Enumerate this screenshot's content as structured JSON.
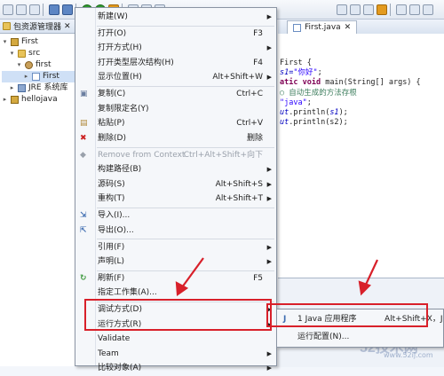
{
  "explorer": {
    "title": "包资源管理器",
    "tree": [
      {
        "label": "First",
        "level": 0,
        "expanded": true,
        "icon": "project-icon"
      },
      {
        "label": "src",
        "level": 1,
        "expanded": true,
        "icon": "folder-icon"
      },
      {
        "label": "first",
        "level": 2,
        "expanded": true,
        "icon": "package-icon"
      },
      {
        "label": "First",
        "level": 3,
        "expanded": false,
        "icon": "java-file-icon"
      },
      {
        "label": "JRE 系统库",
        "level": 1,
        "expanded": false,
        "icon": "library-icon"
      },
      {
        "label": "hellojava",
        "level": 0,
        "expanded": false,
        "icon": "project-icon"
      }
    ]
  },
  "editor": {
    "tab_label": "First.java",
    "lines": [
      {
        "parts": [
          {
            "t": "First {",
            "c": ""
          }
        ]
      },
      {
        "parts": [
          {
            "t": "s1=",
            "c": "fld"
          },
          {
            "t": "\"你好\"",
            "c": "str"
          },
          {
            "t": ";",
            "c": ""
          }
        ]
      },
      {
        "parts": [
          {
            "t": "atic ",
            "c": "kw"
          },
          {
            "t": "void",
            "c": "kw"
          },
          {
            "t": " main(String[] args) {",
            "c": ""
          }
        ]
      },
      {
        "parts": [
          {
            "t": "○ 自动生成的方法存根",
            "c": "com"
          }
        ]
      },
      {
        "parts": [
          {
            "t": "\"java\"",
            "c": "str"
          },
          {
            "t": ";",
            "c": ""
          }
        ]
      },
      {
        "parts": [
          {
            "t": "ut",
            "c": "fld"
          },
          {
            "t": ".println(",
            "c": ""
          },
          {
            "t": "s1",
            "c": "fld"
          },
          {
            "t": ");",
            "c": ""
          }
        ]
      },
      {
        "parts": [
          {
            "t": "ut",
            "c": "fld"
          },
          {
            "t": ".println(s2);",
            "c": ""
          }
        ]
      }
    ]
  },
  "context_menu": {
    "items": [
      {
        "label": "新建(W)",
        "shortcut": "",
        "arrow": true,
        "icon": ""
      },
      {
        "sep": true
      },
      {
        "label": "打开(O)",
        "shortcut": "F3",
        "arrow": false,
        "icon": ""
      },
      {
        "label": "打开方式(H)",
        "shortcut": "",
        "arrow": true,
        "icon": ""
      },
      {
        "label": "打开类型层次结构(H)",
        "shortcut": "F4",
        "arrow": false,
        "icon": ""
      },
      {
        "label": "显示位置(H)",
        "shortcut": "Alt+Shift+W",
        "arrow": true,
        "icon": ""
      },
      {
        "sep": true
      },
      {
        "label": "复制(C)",
        "shortcut": "Ctrl+C",
        "arrow": false,
        "icon": "copy-icon"
      },
      {
        "label": "复制限定名(Y)",
        "shortcut": "",
        "arrow": false,
        "icon": ""
      },
      {
        "label": "粘贴(P)",
        "shortcut": "Ctrl+V",
        "arrow": false,
        "icon": "paste-icon"
      },
      {
        "label": "删除(D)",
        "shortcut": "删除",
        "arrow": false,
        "icon": "delete-icon"
      },
      {
        "sep": true
      },
      {
        "label": "Remove from Context",
        "shortcut": "Ctrl+Alt+Shift+向下",
        "arrow": false,
        "icon": "remove-context-icon",
        "disabled": true
      },
      {
        "label": "构建路径(B)",
        "shortcut": "",
        "arrow": true,
        "icon": ""
      },
      {
        "label": "源码(S)",
        "shortcut": "Alt+Shift+S",
        "arrow": true,
        "icon": ""
      },
      {
        "label": "重构(T)",
        "shortcut": "Alt+Shift+T",
        "arrow": true,
        "icon": ""
      },
      {
        "sep": true
      },
      {
        "label": "导入(I)...",
        "shortcut": "",
        "arrow": false,
        "icon": "import-icon"
      },
      {
        "label": "导出(O)...",
        "shortcut": "",
        "arrow": false,
        "icon": "export-icon"
      },
      {
        "sep": true
      },
      {
        "label": "引用(F)",
        "shortcut": "",
        "arrow": true,
        "icon": ""
      },
      {
        "label": "声明(L)",
        "shortcut": "",
        "arrow": true,
        "icon": ""
      },
      {
        "sep": true
      },
      {
        "label": "刷新(F)",
        "shortcut": "F5",
        "arrow": false,
        "icon": "refresh-icon"
      },
      {
        "label": "指定工作集(A)...",
        "shortcut": "",
        "arrow": false,
        "icon": ""
      },
      {
        "sep": true
      },
      {
        "label": "调试方式(D)",
        "shortcut": "",
        "arrow": true,
        "icon": ""
      },
      {
        "label": "运行方式(R)",
        "shortcut": "",
        "arrow": true,
        "icon": "",
        "highlight": true
      },
      {
        "label": "Validate",
        "shortcut": "",
        "arrow": false,
        "icon": ""
      },
      {
        "label": "Team",
        "shortcut": "",
        "arrow": true,
        "icon": ""
      },
      {
        "label": "比较对象(A)",
        "shortcut": "",
        "arrow": true,
        "icon": ""
      }
    ]
  },
  "submenu": {
    "items": [
      {
        "label": "1 Java 应用程序",
        "shortcut": "Alt+Shift+X，J",
        "icon": "java-app-icon"
      },
      {
        "label": "运行配置(N)...",
        "shortcut": "",
        "icon": ""
      }
    ]
  },
  "bottom": {
    "watermark": "52技术网",
    "watermark_url": "www.52ij.com"
  },
  "colors": {
    "annotation_red": "#d8202a",
    "keyword": "#7f0055",
    "string": "#2a00ff",
    "comment": "#3f7f5f"
  }
}
